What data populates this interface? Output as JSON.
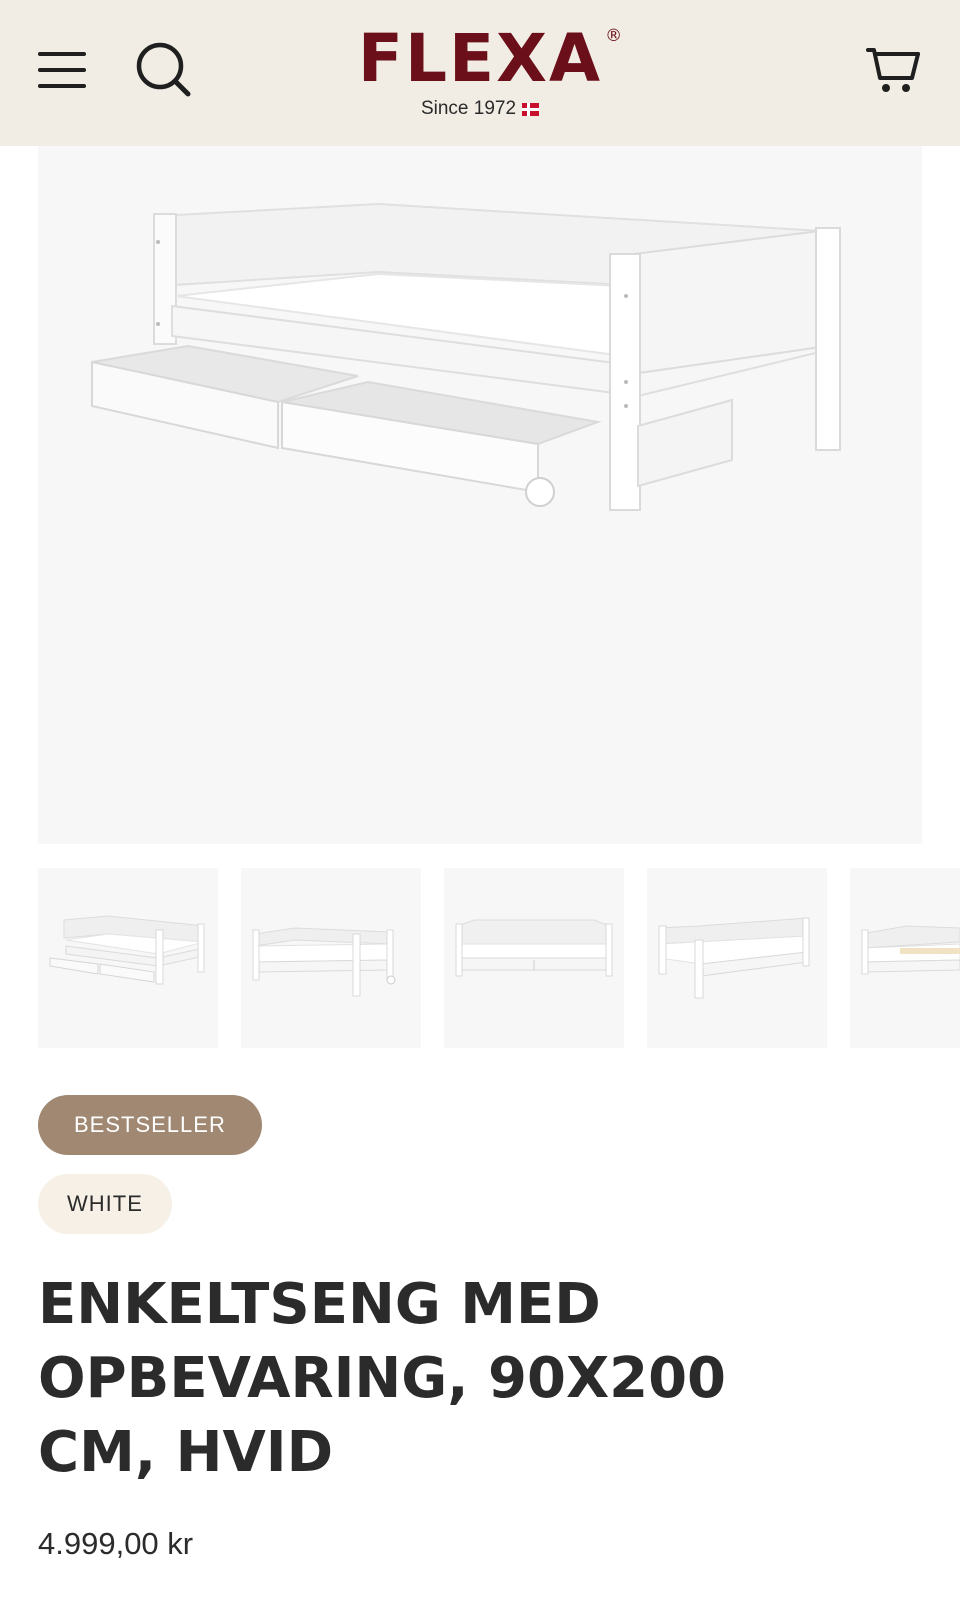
{
  "header": {
    "menu_icon": "hamburger-menu-icon",
    "search_icon": "search-icon",
    "cart_icon": "shopping-cart-icon",
    "logo": {
      "name": "FLEXA",
      "registered": "®",
      "tagline": "Since 1972",
      "flag_icon": "denmark-flag-icon"
    },
    "background_color": "#f2ede4",
    "brand_color": "#6b0f1a"
  },
  "gallery": {
    "main_image_alt": "product-main-image",
    "thumbnails_count_visible": 5,
    "active_thumbnail_index": 0,
    "active_indicator_color": "#d8cc96"
  },
  "product": {
    "badges": {
      "bestseller": "BESTSELLER",
      "color": "WHITE"
    },
    "title": "ENKELTSENG MED OPBEVARING, 90X200 CM, HVID",
    "price": "4.999,00 kr"
  },
  "colors": {
    "bestseller_badge_bg": "#a08872",
    "color_badge_bg": "#f6f0e6",
    "text": "#2b2b2b"
  }
}
